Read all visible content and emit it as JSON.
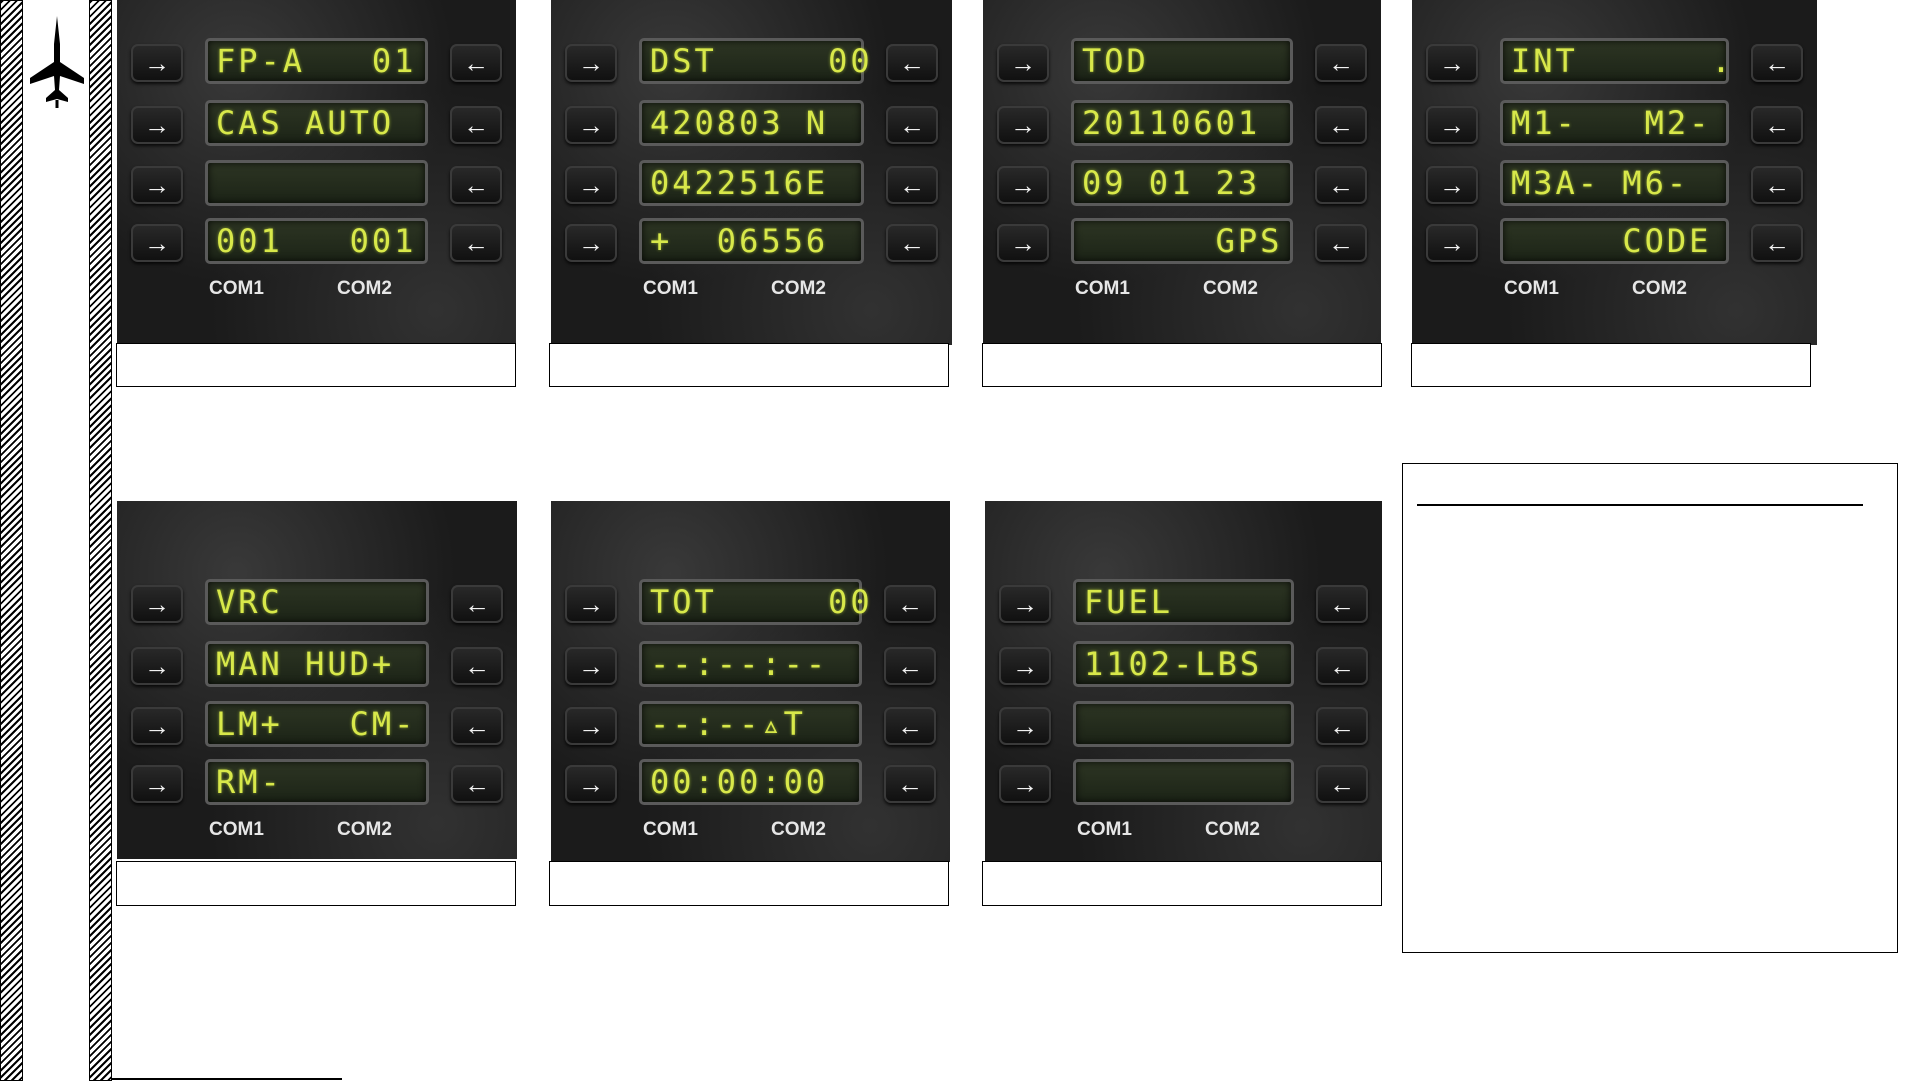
{
  "labels": {
    "com1": "COM1",
    "com2": "COM2"
  },
  "arrows": {
    "left": "→",
    "right": "←"
  },
  "panels": [
    {
      "lines": [
        "FP-A   01",
        "CAS AUTO",
        "",
        "001   001"
      ]
    },
    {
      "lines": [
        "DST     00",
        "420803 N",
        "0422516E",
        "+  06556"
      ]
    },
    {
      "lines": [
        "TOD",
        "20110601",
        "09 01 23",
        "      GPS"
      ]
    },
    {
      "lines": [
        "INT      .",
        "M1-   M2-",
        "M3A- M6-",
        "     CODE"
      ]
    },
    {
      "lines": [
        "VRC",
        "MAN HUD+",
        "LM+   CM-",
        "RM-"
      ]
    },
    {
      "lines": [
        "TOT     00",
        "--:--:--",
        "--:--▵T",
        "00:00:00"
      ]
    },
    {
      "lines": [
        "FUEL",
        "1102-LBS",
        "",
        ""
      ]
    }
  ]
}
